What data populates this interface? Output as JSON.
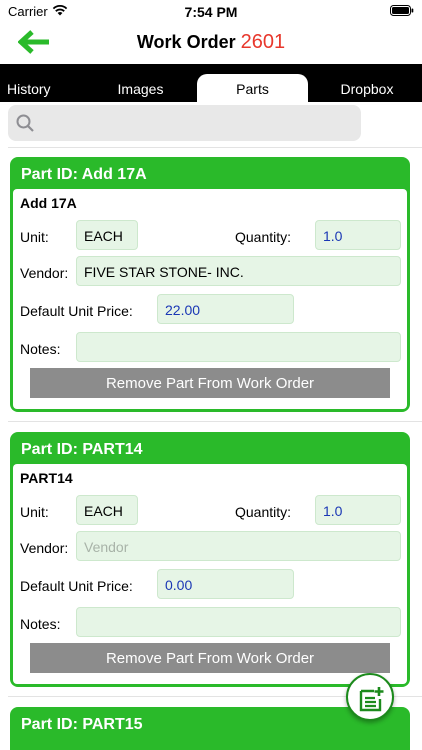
{
  "status_bar": {
    "carrier": "Carrier",
    "time": "7:54 PM"
  },
  "nav": {
    "title": "Work Order",
    "number": "2601"
  },
  "tabs": [
    {
      "label": "History"
    },
    {
      "label": "Images"
    },
    {
      "label": "Parts",
      "active": true
    },
    {
      "label": "Dropbox"
    }
  ],
  "search": {
    "placeholder": ""
  },
  "labels": {
    "unit": "Unit:",
    "quantity": "Quantity:",
    "vendor": "Vendor:",
    "default_unit_price": "Default Unit Price:",
    "notes": "Notes:",
    "remove": "Remove Part From Work Order",
    "vendor_placeholder": "Vendor"
  },
  "parts": [
    {
      "header": "Part ID: Add 17A",
      "name": "Add 17A",
      "unit": "EACH",
      "quantity": "1.0",
      "vendor": "FIVE STAR STONE- INC.",
      "price": "22.00",
      "notes": ""
    },
    {
      "header": "Part ID: PART14",
      "name": "PART14",
      "unit": "EACH",
      "quantity": "1.0",
      "vendor": "",
      "price": "0.00",
      "notes": ""
    },
    {
      "header": "Part ID: PART15"
    }
  ],
  "colors": {
    "accent": "#2aba2a",
    "title_number": "#e8372c",
    "value_blue": "#1a37b5"
  },
  "icons": {
    "back": "arrow-left-icon",
    "search": "magnifier-icon",
    "fab": "note-add-icon"
  }
}
